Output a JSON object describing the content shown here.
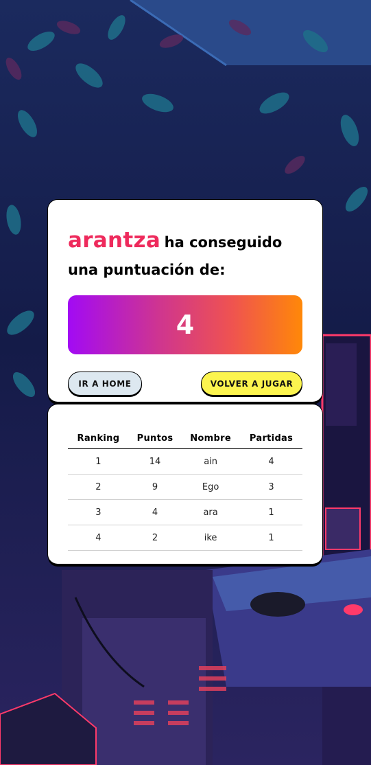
{
  "result": {
    "player_name": "arantza",
    "message": "ha conseguido una puntuación de:",
    "score": "4"
  },
  "actions": {
    "home_label": "IR A HOME",
    "replay_label": "VOLVER A JUGAR"
  },
  "ranking": {
    "headers": [
      "Ranking",
      "Puntos",
      "Nombre",
      "Partidas"
    ],
    "rows": [
      [
        "1",
        "14",
        "ain",
        "4"
      ],
      [
        "2",
        "9",
        "Ego",
        "3"
      ],
      [
        "3",
        "4",
        "ara",
        "1"
      ],
      [
        "4",
        "2",
        "ike",
        "1"
      ]
    ]
  },
  "colors": {
    "player_name": "#ee2a5c",
    "home_button": "#dde8f0",
    "replay_button": "#fcf44f",
    "score_gradient": [
      "#a20af4",
      "#ff8808"
    ]
  }
}
